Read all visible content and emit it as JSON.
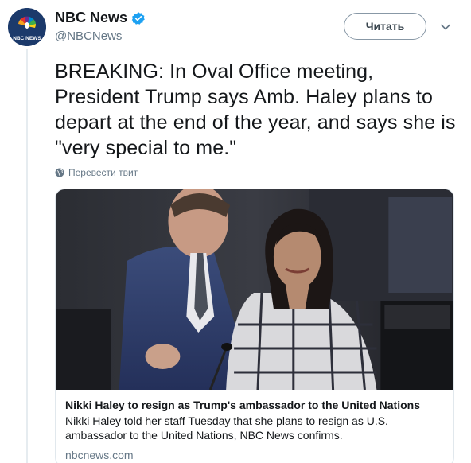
{
  "author": {
    "display_name": "NBC News",
    "handle": "@NBCNews",
    "avatar_text": "NBC NEWS",
    "verified": true
  },
  "actions": {
    "follow_label": "Читать",
    "more_icon": "chevron-down-icon"
  },
  "tweet": {
    "text": "BREAKING: In Oval Office meeting, President Trump says Amb. Haley plans to depart at the end of the year, and says she is \"very special to me.\"",
    "translate_label": "Перевести твит"
  },
  "card": {
    "title": "Nikki Haley to resign as Trump's ambassador to the United Nations",
    "description": "Nikki Haley told her staff Tuesday that she plans to resign as U.S. ambassador to the United Nations, NBC News confirms.",
    "domain": "nbcnews.com",
    "image_alt": "news-photo"
  },
  "colors": {
    "brand_blue": "#1da1f2",
    "text_primary": "#14171a",
    "text_secondary": "#657786",
    "border": "#e1e8ed"
  }
}
